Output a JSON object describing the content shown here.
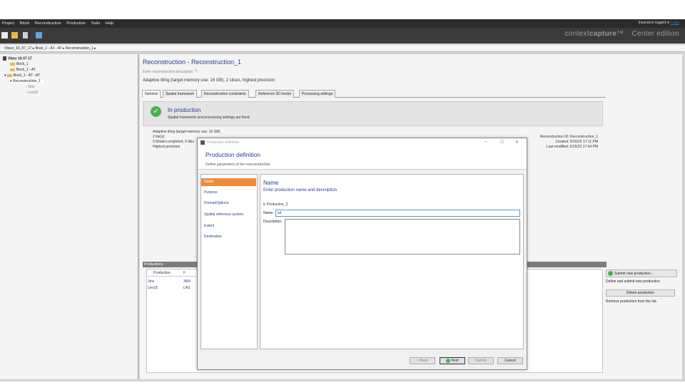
{
  "menu": [
    "Project",
    "Block",
    "Reconstruction",
    "Production",
    "Tools",
    "Help"
  ],
  "login": {
    "prefix": "Insurance logged in",
    "link": "Login"
  },
  "brand": {
    "prefix": "context",
    "name": "capture",
    "tm": "™",
    "edition": "Center edition"
  },
  "breadcrumb": "Vbeur_16_07_17  ▸  Bock_1 - AT - AT  ▸  Reconstruction_1  ▸",
  "tree": [
    {
      "label": "Vbiur 16 07 17",
      "level": 0
    },
    {
      "label": "Bock_1",
      "level": 1
    },
    {
      "label": "Bock_1 - AT",
      "level": 1
    },
    {
      "label": "Bock_1 - AT - AT",
      "level": 1
    },
    {
      "label": "Reconstruction_1",
      "level": 2
    },
    {
      "label": "3mx",
      "level": 3
    },
    {
      "label": "Lev18",
      "level": 3
    }
  ],
  "reconstruction": {
    "title": "Reconstruction - Reconstruction_1",
    "subtitle": "Enter reconstruction description",
    "description": "Adaptive tiling (target memory use: 16 GB), 2 slices, highest precision"
  },
  "tabs": [
    "General",
    "Spatial framework",
    "Reconstruction constraints",
    "Reference 3D model",
    "Processing settings"
  ],
  "status": {
    "title": "In production",
    "text": "Spatial framework and processing settings are fixed."
  },
  "info_left": [
    "Adaptive tiling (target memory use: 16 GB)",
    "2 tile(s)",
    "0 Model completed, 2 tiles",
    "Highest precision"
  ],
  "info_right": [
    "Reconstruction ID: Reconstruction_1",
    "Created: 5/16/22 17:11 PM",
    "Last modified: 5/16/22 17:34 PM"
  ],
  "productions": {
    "header": "Productions",
    "columns": [
      "Production",
      "F"
    ],
    "rows": [
      [
        "3mx",
        "3MX"
      ],
      [
        "Lev18",
        "LAS"
      ]
    ]
  },
  "side_actions": {
    "submit": "Submit new production...",
    "define": "Define and submit new production.",
    "delete": "Delete production",
    "remove": "Remove production from the list."
  },
  "dialog": {
    "window_title": "Production definition",
    "title": "Production definition",
    "subtitle": "Define parameters of the new production.",
    "nav": [
      "Name",
      "Purpose",
      "Format/Options",
      "Spatial reference system",
      "Extent",
      "Destination"
    ],
    "name_title": "Name",
    "name_sub": "Enter production name and description.",
    "production_label": "ℹ: Production_3",
    "name_label": "Name:",
    "name_value": "cri",
    "desc_label": "Description:",
    "buttons": {
      "back": "< Back",
      "next": "Next",
      "submit": "Submit",
      "cancel": "Cancel"
    }
  }
}
